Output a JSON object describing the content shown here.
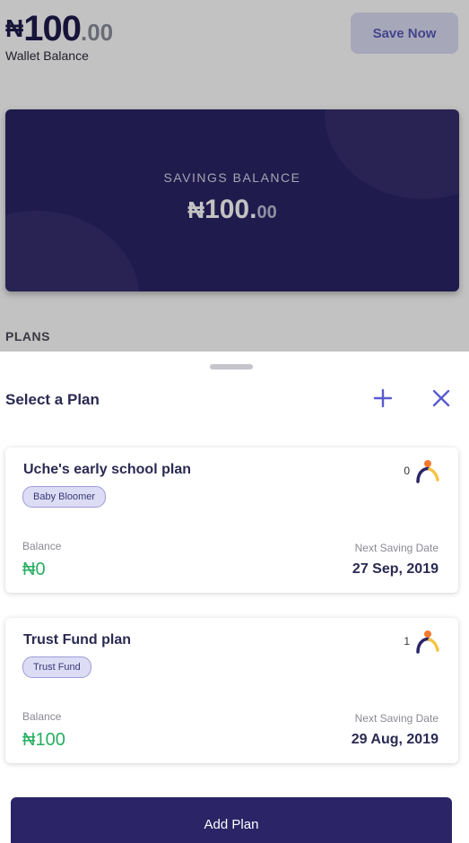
{
  "wallet": {
    "currency": "₦",
    "amount_int": "100",
    "amount_dot": ".",
    "amount_dec": "00",
    "label": "Wallet Balance"
  },
  "save_now_label": "Save Now",
  "savings": {
    "label": "SAVINGS BALANCE",
    "currency": "₦",
    "amount_int": "100",
    "amount_dot": ".",
    "amount_dec": "00"
  },
  "plans_heading": "PLANS",
  "sheet": {
    "title": "Select a Plan",
    "add_icon": "plus-icon",
    "close_icon": "close-icon",
    "plans": [
      {
        "name": "Uche's early school plan",
        "tag": "Baby Bloomer",
        "members": "0",
        "balance_label": "Balance",
        "balance": "₦0",
        "date_label": "Next Saving Date",
        "date": "27 Sep, 2019"
      },
      {
        "name": "Trust Fund plan",
        "tag": "Trust Fund",
        "members": "1",
        "balance_label": "Balance",
        "balance": "₦100",
        "date_label": "Next Saving Date",
        "date": "29 Aug, 2019"
      }
    ],
    "add_plan_label": "Add Plan"
  },
  "colors": {
    "primary": "#2b2466",
    "accent": "#5a5ad0",
    "positive": "#27ae60",
    "tag_bg": "#dcdcf5"
  }
}
